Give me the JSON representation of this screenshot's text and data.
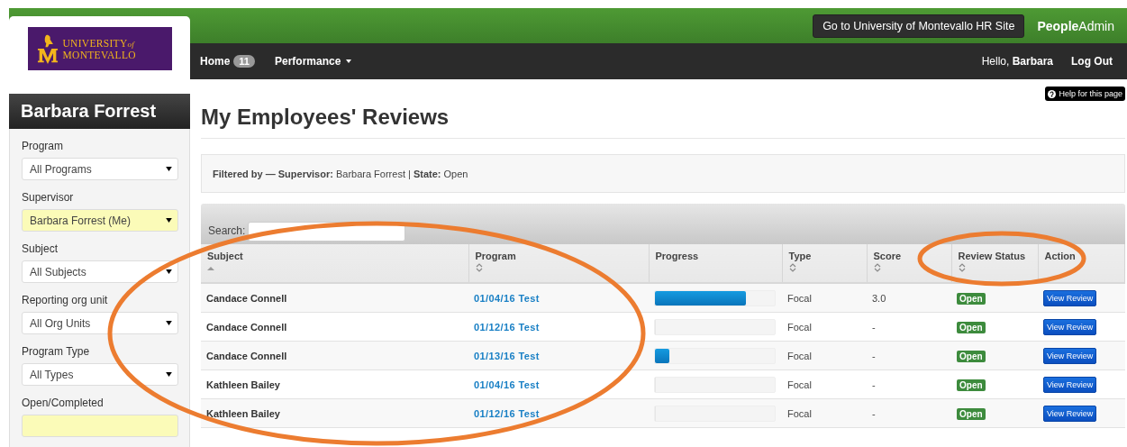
{
  "header": {
    "logo": {
      "line1": "UNIVERSITY",
      "of": "of",
      "line2": "MONTEVALLO"
    },
    "hr_site_button": "Go to University of Montevallo HR Site",
    "brand": "**People**Admin",
    "nav": [
      {
        "label": "Home",
        "badge": "11",
        "dropdown": false
      },
      {
        "label": "Performance",
        "dropdown": true
      }
    ],
    "greeting": "Hello,",
    "user": "Barbara",
    "logout": "Log Out"
  },
  "help": "Help for this page",
  "sidebar": {
    "title": "Barbara Forrest",
    "filters": [
      {
        "label": "Program",
        "value": "All Programs",
        "highlighted": false
      },
      {
        "label": "Supervisor",
        "value": "Barbara Forrest (Me)",
        "highlighted": true
      },
      {
        "label": "Subject",
        "value": "All Subjects",
        "highlighted": false
      },
      {
        "label": "Reporting org unit",
        "value": "All Org Units",
        "highlighted": false
      },
      {
        "label": "Program Type",
        "value": "All Types",
        "highlighted": false
      },
      {
        "label": "Open/Completed",
        "highlighted": true
      }
    ]
  },
  "page_title": "My Employees' Reviews",
  "filter_summary": "**Filtered by — Supervisor:** Barbara Forrest | **State:** Open",
  "table": {
    "search_label": "Search:",
    "columns": [
      {
        "label": "Subject",
        "sortable": true,
        "sorted": true
      },
      {
        "label": "Program",
        "sortable": true,
        "sorted": false
      },
      {
        "label": "Progress",
        "sortable": false
      },
      {
        "label": "Type",
        "sortable": true,
        "sorted": false
      },
      {
        "label": "Score",
        "sortable": true,
        "sorted": false
      },
      {
        "label": "Review Status",
        "sortable": true,
        "sorted": false
      },
      {
        "label": "Action",
        "sortable": false
      }
    ],
    "rows": [
      {
        "subject": "Candace Connell",
        "program": "01/04/16 Test",
        "level": 0.76,
        "type": "Focal",
        "score": "3.0",
        "status": "Open",
        "action": "View Review"
      },
      {
        "subject": "Candace Connell",
        "program": "01/12/16 Test",
        "level": 0,
        "type": "Focal",
        "score": "-",
        "status": "Open",
        "action": "View Review"
      },
      {
        "subject": "Candace Connell",
        "program": "01/13/16 Test",
        "level": 0.12,
        "type": "Focal",
        "score": "-",
        "status": "Open",
        "action": "View Review"
      },
      {
        "subject": "Kathleen Bailey",
        "program": "01/04/16 Test",
        "level": 0,
        "type": "Focal",
        "score": "-",
        "status": "Open",
        "action": "View Review"
      },
      {
        "subject": "Kathleen Bailey",
        "program": "01/12/16 Test",
        "level": 0,
        "type": "Focal",
        "score": "-",
        "status": "Open",
        "action": "View Review"
      }
    ]
  }
}
